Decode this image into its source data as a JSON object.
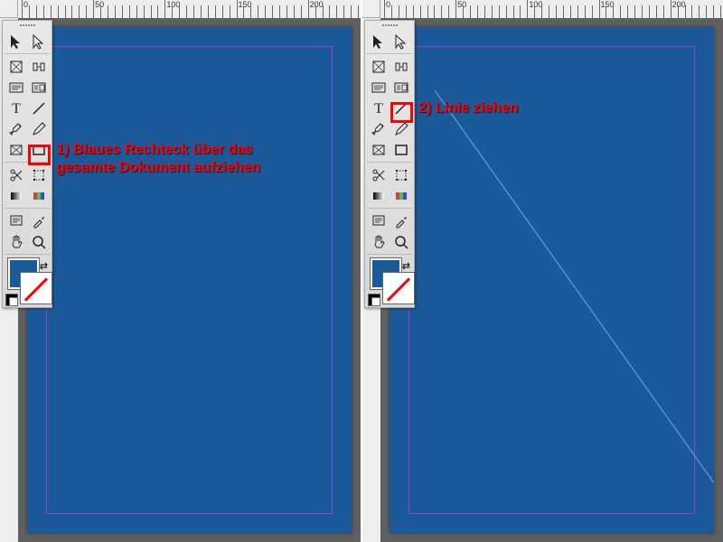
{
  "ruler_labels": [
    "0",
    "50",
    "100",
    "150",
    "200"
  ],
  "toolbox": {
    "tools": [
      [
        "selection",
        "direct-selection"
      ],
      [
        "page",
        "gap"
      ],
      [
        "page-content",
        "page-content-alt"
      ],
      [
        "type",
        "line"
      ],
      [
        "pen",
        "pencil"
      ],
      [
        "frame-rectangle",
        "rectangle"
      ],
      [
        "scissors",
        "free-transform"
      ],
      [
        "gradient-swatch",
        "color-theme"
      ],
      [
        "note",
        "eyedropper"
      ],
      [
        "hand",
        "zoom"
      ]
    ]
  },
  "annotations": {
    "left": {
      "lines": [
        "1) Blaues Rechteck über das",
        "gesamte Dokument aufziehen"
      ]
    },
    "right": {
      "lines": [
        "2) Linie ziehen"
      ]
    }
  },
  "highlight": {
    "left_target": "rectangle",
    "right_target": "line"
  },
  "colors": {
    "page_bg": "#1b5a9a",
    "margin_guide": "#9c3bd8",
    "annotation": "#ff0000"
  }
}
